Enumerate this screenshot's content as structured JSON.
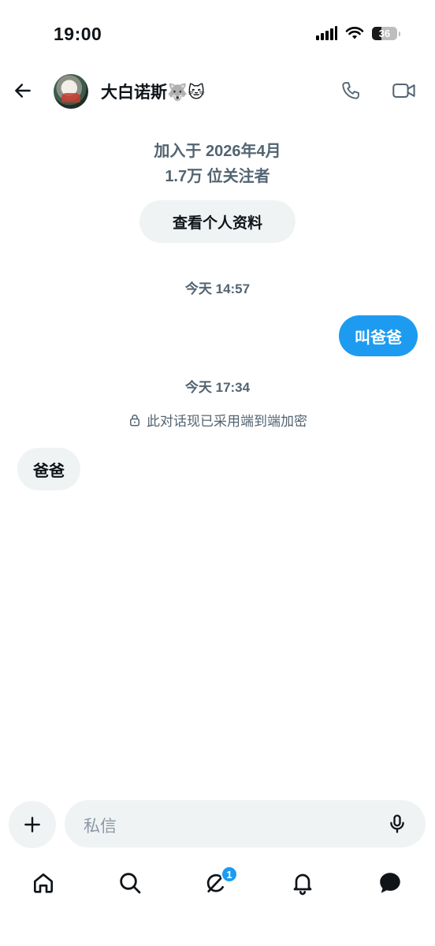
{
  "status_bar": {
    "time": "19:00",
    "battery": "36",
    "icons": [
      "signal-icon",
      "wifi-icon",
      "battery-icon"
    ]
  },
  "header": {
    "contact_name": "大白诺斯🐺🐱",
    "icons": [
      "back-arrow-icon",
      "avatar",
      "phone-icon",
      "video-camera-icon"
    ]
  },
  "profile": {
    "join_date": "加入于 2026年4月",
    "followers": "1.7万 位关注者",
    "view_profile_label": "查看个人资料"
  },
  "conversation": {
    "messages": [
      {
        "timestamp": "今天 14:57",
        "direction": "sent",
        "text": "叫爸爸"
      },
      {
        "timestamp": "今天 17:34",
        "direction": "received",
        "text": "爸爸"
      }
    ],
    "encryption_notice": "此对话现已采用端到端加密"
  },
  "composer": {
    "placeholder": "私信",
    "icons": [
      "plus-icon",
      "microphone-icon"
    ]
  },
  "tab_bar": {
    "items": [
      {
        "name": "home",
        "icon": "home-icon"
      },
      {
        "name": "search",
        "icon": "search-icon"
      },
      {
        "name": "grok",
        "icon": "grok-icon",
        "badge": "1"
      },
      {
        "name": "notifications",
        "icon": "bell-icon"
      },
      {
        "name": "messages",
        "icon": "chat-bubble-icon"
      }
    ]
  },
  "colors": {
    "accent": "#1d9bf0",
    "bubble_received": "#eff3f4",
    "secondary_text": "#536471"
  }
}
